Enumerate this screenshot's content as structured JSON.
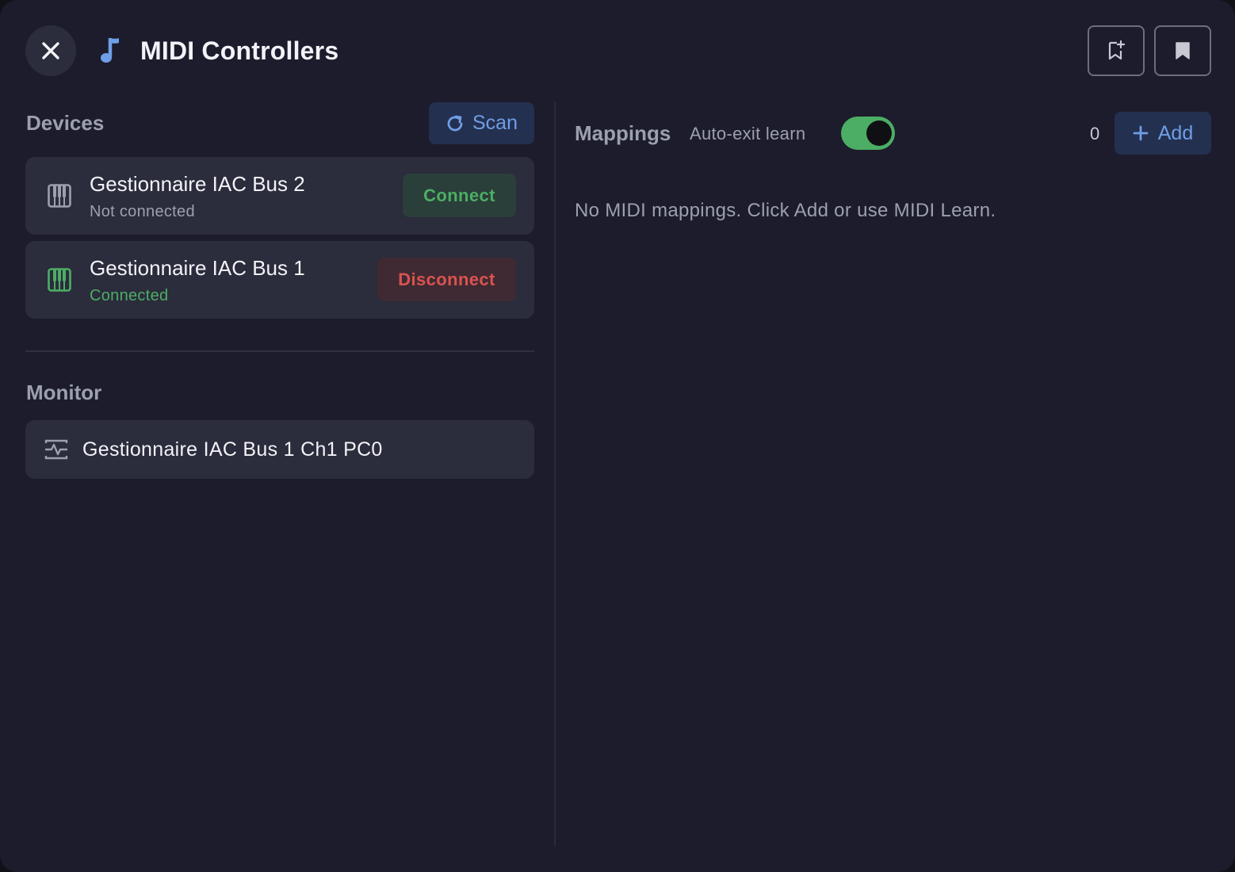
{
  "header": {
    "title": "MIDI Controllers",
    "icons": {
      "close": "close-icon",
      "title": "music-note-icon",
      "bookmark_add": "bookmark-add-icon",
      "bookmark": "bookmark-icon"
    }
  },
  "devices": {
    "section_title": "Devices",
    "scan_label": "Scan",
    "items": [
      {
        "name": "Gestionnaire IAC Bus 2",
        "status": "Not connected",
        "action": "Connect",
        "connected": false
      },
      {
        "name": "Gestionnaire IAC Bus 1",
        "status": "Connected",
        "action": "Disconnect",
        "connected": true
      }
    ]
  },
  "monitor": {
    "section_title": "Monitor",
    "events": [
      {
        "text": "Gestionnaire IAC Bus 1 Ch1 PC0"
      }
    ]
  },
  "mappings": {
    "section_title": "Mappings",
    "auto_exit_label": "Auto-exit learn",
    "auto_exit_enabled": true,
    "count": "0",
    "add_label": "Add",
    "empty_message": "No MIDI mappings. Click Add or use MIDI Learn."
  },
  "colors": {
    "accent_blue": "#6f9ee6",
    "success_green": "#4cae64",
    "danger_red": "#d9534f",
    "panel_bg": "#1c1c2c",
    "card_bg": "#2b2c3c"
  }
}
